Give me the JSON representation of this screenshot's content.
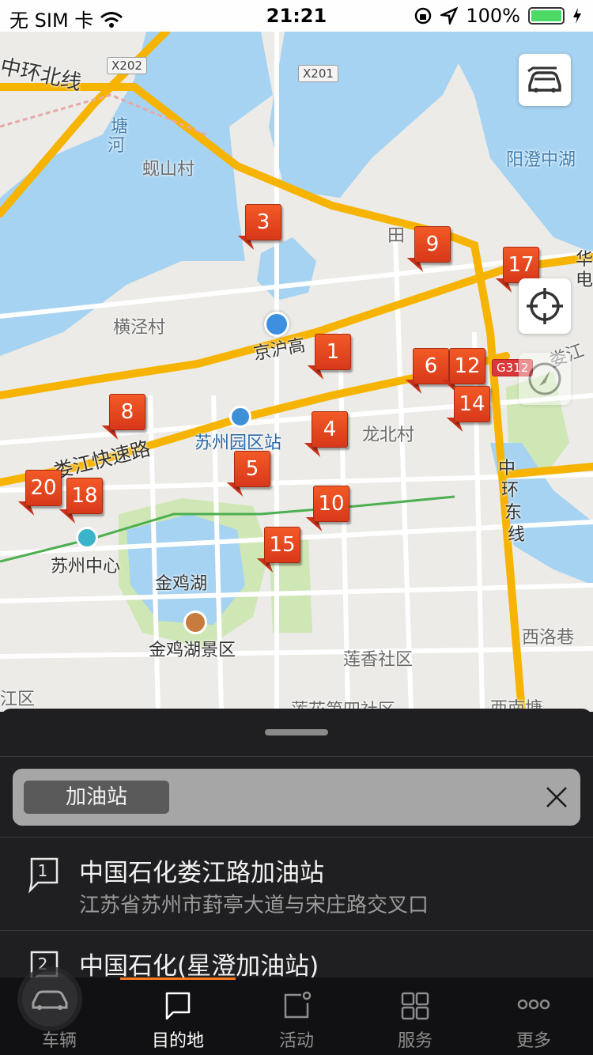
{
  "status": {
    "carrier": "无 SIM 卡",
    "time": "21:21",
    "battery": "100%"
  },
  "map": {
    "road_shields": [
      "X202",
      "X201",
      "G312"
    ],
    "labels": [
      {
        "text": "中环北线",
        "kind": "dark"
      },
      {
        "text": "塘",
        "kind": "water"
      },
      {
        "text": "河",
        "kind": "water"
      },
      {
        "text": "蚬山村",
        "kind": "place"
      },
      {
        "text": "阳澄中湖",
        "kind": "water"
      },
      {
        "text": "田",
        "kind": "place"
      },
      {
        "text": "华",
        "kind": "dark"
      },
      {
        "text": "电",
        "kind": "dark"
      },
      {
        "text": "横泾村",
        "kind": "place"
      },
      {
        "text": "京沪高",
        "kind": "dark"
      },
      {
        "text": "娄江",
        "kind": "place"
      },
      {
        "text": "龙北村",
        "kind": "place"
      },
      {
        "text": "苏州园区站",
        "kind": "blue"
      },
      {
        "text": "娄江快速路",
        "kind": "dark"
      },
      {
        "text": "中",
        "kind": "dark"
      },
      {
        "text": "环",
        "kind": "dark"
      },
      {
        "text": "东",
        "kind": "dark"
      },
      {
        "text": "线",
        "kind": "dark"
      },
      {
        "text": "苏州中心",
        "kind": "dark"
      },
      {
        "text": "金鸡湖",
        "kind": "water"
      },
      {
        "text": "金鸡湖景区",
        "kind": "dark"
      },
      {
        "text": "西洛巷",
        "kind": "place"
      },
      {
        "text": "莲香社区",
        "kind": "place"
      },
      {
        "text": "江区",
        "kind": "place"
      },
      {
        "text": "莲花第四社区",
        "kind": "place"
      },
      {
        "text": "西南塘",
        "kind": "place"
      }
    ],
    "markers": [
      "3",
      "9",
      "17",
      "1",
      "6",
      "12",
      "14",
      "8",
      "4",
      "5",
      "20",
      "18",
      "10",
      "15"
    ]
  },
  "map_controls": {
    "car_view_icon": "car-view-icon",
    "locate_icon": "locate-icon",
    "compass_icon": "compass-icon"
  },
  "search": {
    "chip_label": "加油站",
    "clear_icon": "close-icon"
  },
  "results": [
    {
      "index": "1",
      "name": "中国石化娄江路加油站",
      "address": "江苏省苏州市葑亭大道与宋庄路交叉口"
    },
    {
      "index": "2",
      "name": "中国石化(星澄加油站)",
      "address": ""
    }
  ],
  "tabs": [
    {
      "label": "车辆",
      "icon": "car-icon"
    },
    {
      "label": "目的地",
      "icon": "destination-icon"
    },
    {
      "label": "活动",
      "icon": "activity-icon"
    },
    {
      "label": "服务",
      "icon": "grid-icon"
    },
    {
      "label": "更多",
      "icon": "more-icon"
    }
  ],
  "active_tab": "目的地",
  "colors": {
    "marker": "#e5461f",
    "accent": "#f47b20",
    "highway": "#f6b400",
    "water": "#a6d3f2",
    "park": "#cfe6b5"
  }
}
